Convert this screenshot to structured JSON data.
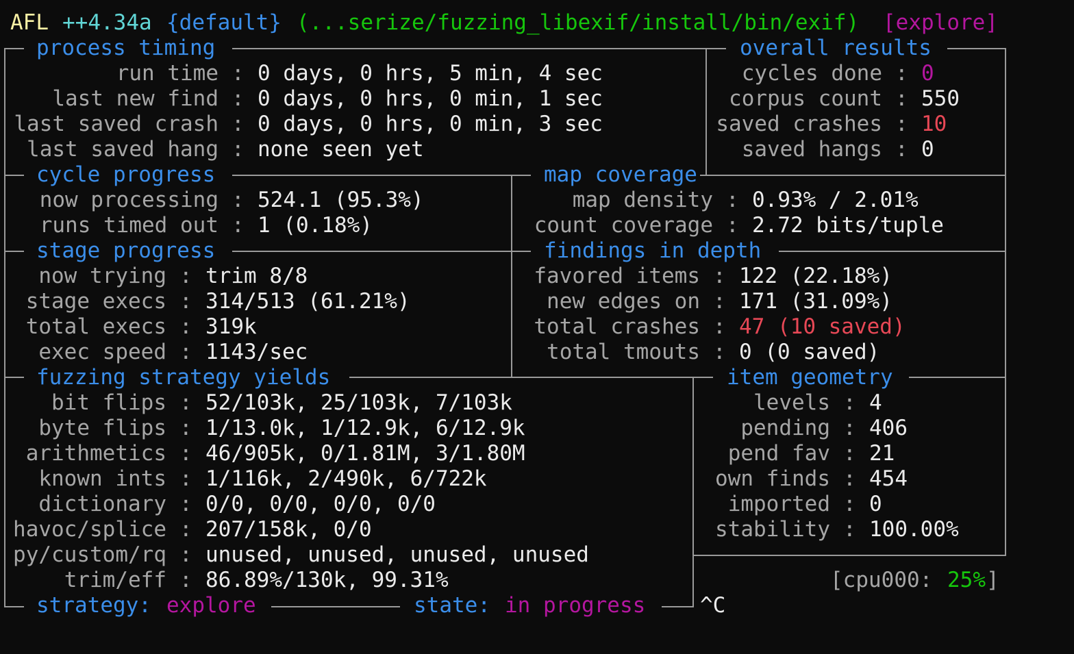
{
  "title": {
    "afl": "AFL",
    "version": "++4.34a",
    "banner": "{default}",
    "target": "(...serize/fuzzing_libexif/install/bin/exif)",
    "power": "[explore]"
  },
  "process_timing": {
    "header": "process timing",
    "rows": [
      {
        "label": "run time",
        "value": "0 days, 0 hrs, 5 min, 4 sec"
      },
      {
        "label": "last new find",
        "value": "0 days, 0 hrs, 0 min, 1 sec"
      },
      {
        "label": "last saved crash",
        "value": "0 days, 0 hrs, 0 min, 3 sec"
      },
      {
        "label": "last saved hang",
        "value": "none seen yet"
      }
    ]
  },
  "overall_results": {
    "header": "overall results",
    "rows": [
      {
        "label": "cycles done",
        "value": "0"
      },
      {
        "label": "corpus count",
        "value": "550"
      },
      {
        "label": "saved crashes",
        "value": "10"
      },
      {
        "label": "saved hangs",
        "value": "0"
      }
    ]
  },
  "cycle_progress": {
    "header": "cycle progress",
    "rows": [
      {
        "label": "now processing",
        "value": "524.1 (95.3%)"
      },
      {
        "label": "runs timed out",
        "value": "1 (0.18%)"
      }
    ]
  },
  "map_coverage": {
    "header": "map coverage",
    "rows": [
      {
        "label": "map density",
        "value": "0.93% / 2.01%"
      },
      {
        "label": "count coverage",
        "value": "2.72 bits/tuple"
      }
    ]
  },
  "stage_progress": {
    "header": "stage progress",
    "rows": [
      {
        "label": "now trying",
        "value": "trim 8/8"
      },
      {
        "label": "stage execs",
        "value": "314/513 (61.21%)"
      },
      {
        "label": "total execs",
        "value": "319k"
      },
      {
        "label": "exec speed",
        "value": "1143/sec"
      }
    ]
  },
  "findings_in_depth": {
    "header": "findings in depth",
    "rows": [
      {
        "label": "favored items",
        "value": "122 (22.18%)"
      },
      {
        "label": "new edges on",
        "value": "171 (31.09%)"
      },
      {
        "label": "total crashes",
        "value": "47 (10 saved)"
      },
      {
        "label": "total tmouts",
        "value": "0 (0 saved)"
      }
    ]
  },
  "fuzzing_strategy_yields": {
    "header": "fuzzing strategy yields",
    "rows": [
      {
        "label": "bit flips",
        "value": "52/103k, 25/103k, 7/103k"
      },
      {
        "label": "byte flips",
        "value": "1/13.0k, 1/12.9k, 6/12.9k"
      },
      {
        "label": "arithmetics",
        "value": "46/905k, 0/1.81M, 3/1.80M"
      },
      {
        "label": "known ints",
        "value": "1/116k, 2/490k, 6/722k"
      },
      {
        "label": "dictionary",
        "value": "0/0, 0/0, 0/0, 0/0"
      },
      {
        "label": "havoc/splice",
        "value": "207/158k, 0/0"
      },
      {
        "label": "py/custom/rq",
        "value": "unused, unused, unused, unused"
      },
      {
        "label": "trim/eff",
        "value": "86.89%/130k, 99.31%"
      }
    ]
  },
  "item_geometry": {
    "header": "item geometry",
    "rows": [
      {
        "label": "levels",
        "value": "4"
      },
      {
        "label": "pending",
        "value": "406"
      },
      {
        "label": "pend fav",
        "value": "21"
      },
      {
        "label": "own finds",
        "value": "454"
      },
      {
        "label": "imported",
        "value": "0"
      },
      {
        "label": "stability",
        "value": "100.00%"
      }
    ]
  },
  "cpu": {
    "open": "[cpu000:",
    "value": "25%",
    "close": "]"
  },
  "footer": {
    "strategy_label": "strategy:",
    "strategy_value": "explore",
    "state_label": "state:",
    "state_value": "in progress",
    "interrupt": "^C"
  },
  "colors": {
    "background": "#0c0c0c",
    "header_blue": "#3b8eea",
    "label_gray": "#a6a6a6",
    "value_white": "#ebebeb",
    "crash_red": "#e74856",
    "magenta": "#b4169f",
    "cpu_green": "#16c60c",
    "title_yellow": "#f9f1a5",
    "version_cyan": "#61d6d6"
  }
}
